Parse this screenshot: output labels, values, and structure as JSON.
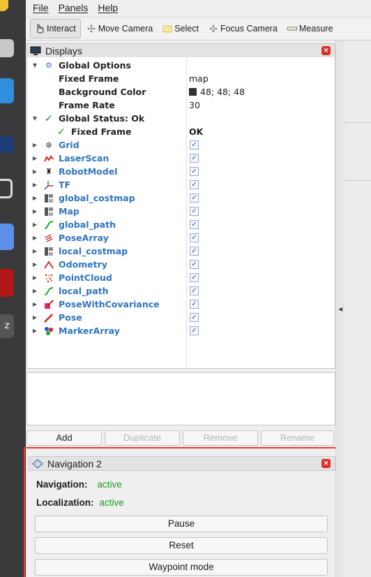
{
  "menu": {
    "items": [
      "File",
      "Panels",
      "Help"
    ]
  },
  "toolbar": {
    "tools": [
      {
        "label": "Interact",
        "icon": "hand-pointer-icon",
        "active": true
      },
      {
        "label": "Move Camera",
        "icon": "move-camera-icon",
        "active": false
      },
      {
        "label": "Select",
        "icon": "select-box-icon",
        "active": false
      },
      {
        "label": "Focus Camera",
        "icon": "focus-camera-icon",
        "active": false
      },
      {
        "label": "Measure",
        "icon": "ruler-icon",
        "active": false
      }
    ]
  },
  "displays": {
    "title": "Displays",
    "global_options": {
      "label": "Global Options",
      "fixed_frame_label": "Fixed Frame",
      "fixed_frame_value": "map",
      "background_label": "Background Color",
      "background_value": "48; 48; 48",
      "background_color": "#303030",
      "frame_rate_label": "Frame Rate",
      "frame_rate_value": "30"
    },
    "global_status": {
      "label": "Global Status: Ok",
      "fixed_frame_label": "Fixed Frame",
      "fixed_frame_value": "OK"
    },
    "items": [
      {
        "label": "Grid",
        "icon": "grid-icon",
        "checked": true
      },
      {
        "label": "LaserScan",
        "icon": "laserscan-icon",
        "checked": true
      },
      {
        "label": "RobotModel",
        "icon": "robot-model-icon",
        "checked": true
      },
      {
        "label": "TF",
        "icon": "tf-axes-icon",
        "checked": true
      },
      {
        "label": "global_costmap",
        "icon": "map-icon",
        "checked": true
      },
      {
        "label": "Map",
        "icon": "map-icon",
        "checked": true
      },
      {
        "label": "global_path",
        "icon": "path-icon",
        "checked": true
      },
      {
        "label": "PoseArray",
        "icon": "pose-array-icon",
        "checked": true
      },
      {
        "label": "local_costmap",
        "icon": "map-icon",
        "checked": true
      },
      {
        "label": "Odometry",
        "icon": "odometry-icon",
        "checked": true
      },
      {
        "label": "PointCloud",
        "icon": "pointcloud-icon",
        "checked": true
      },
      {
        "label": "local_path",
        "icon": "path-icon",
        "checked": true
      },
      {
        "label": "PoseWithCovariance",
        "icon": "pose-covariance-icon",
        "checked": true
      },
      {
        "label": "Pose",
        "icon": "pose-arrow-icon",
        "checked": true
      },
      {
        "label": "MarkerArray",
        "icon": "marker-array-icon",
        "checked": true
      }
    ],
    "buttons": {
      "add": "Add",
      "duplicate": "Duplicate",
      "remove": "Remove",
      "rename": "Rename"
    }
  },
  "navigation": {
    "title": "Navigation 2",
    "nav_label": "Navigation:",
    "nav_status": "active",
    "loc_label": "Localization:",
    "loc_status": "active",
    "pause": "Pause",
    "reset": "Reset",
    "waypoint": "Waypoint mode",
    "status_color": "#1e9b1e",
    "highlight_color": "#e03b36"
  }
}
